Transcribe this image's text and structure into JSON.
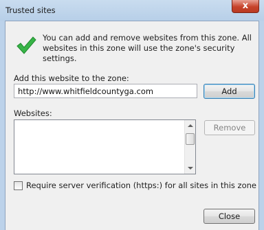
{
  "window": {
    "title": "Trusted sites",
    "close_label": "x"
  },
  "intro": {
    "text": "You can add and remove websites from this zone. All websites in this zone will use the zone's security settings."
  },
  "add_site": {
    "label": "Add this website to the zone:",
    "value": "http://www.whitfieldcountyga.com",
    "button": "Add"
  },
  "websites": {
    "label": "Websites:",
    "items": [],
    "remove_button": "Remove"
  },
  "verify": {
    "label": "Require server verification (https:) for all sites in this zone",
    "checked": false
  },
  "footer": {
    "close_button": "Close"
  },
  "icons": [
    "checkmark-icon",
    "close-icon",
    "scroll-up-icon",
    "scroll-down-icon"
  ]
}
